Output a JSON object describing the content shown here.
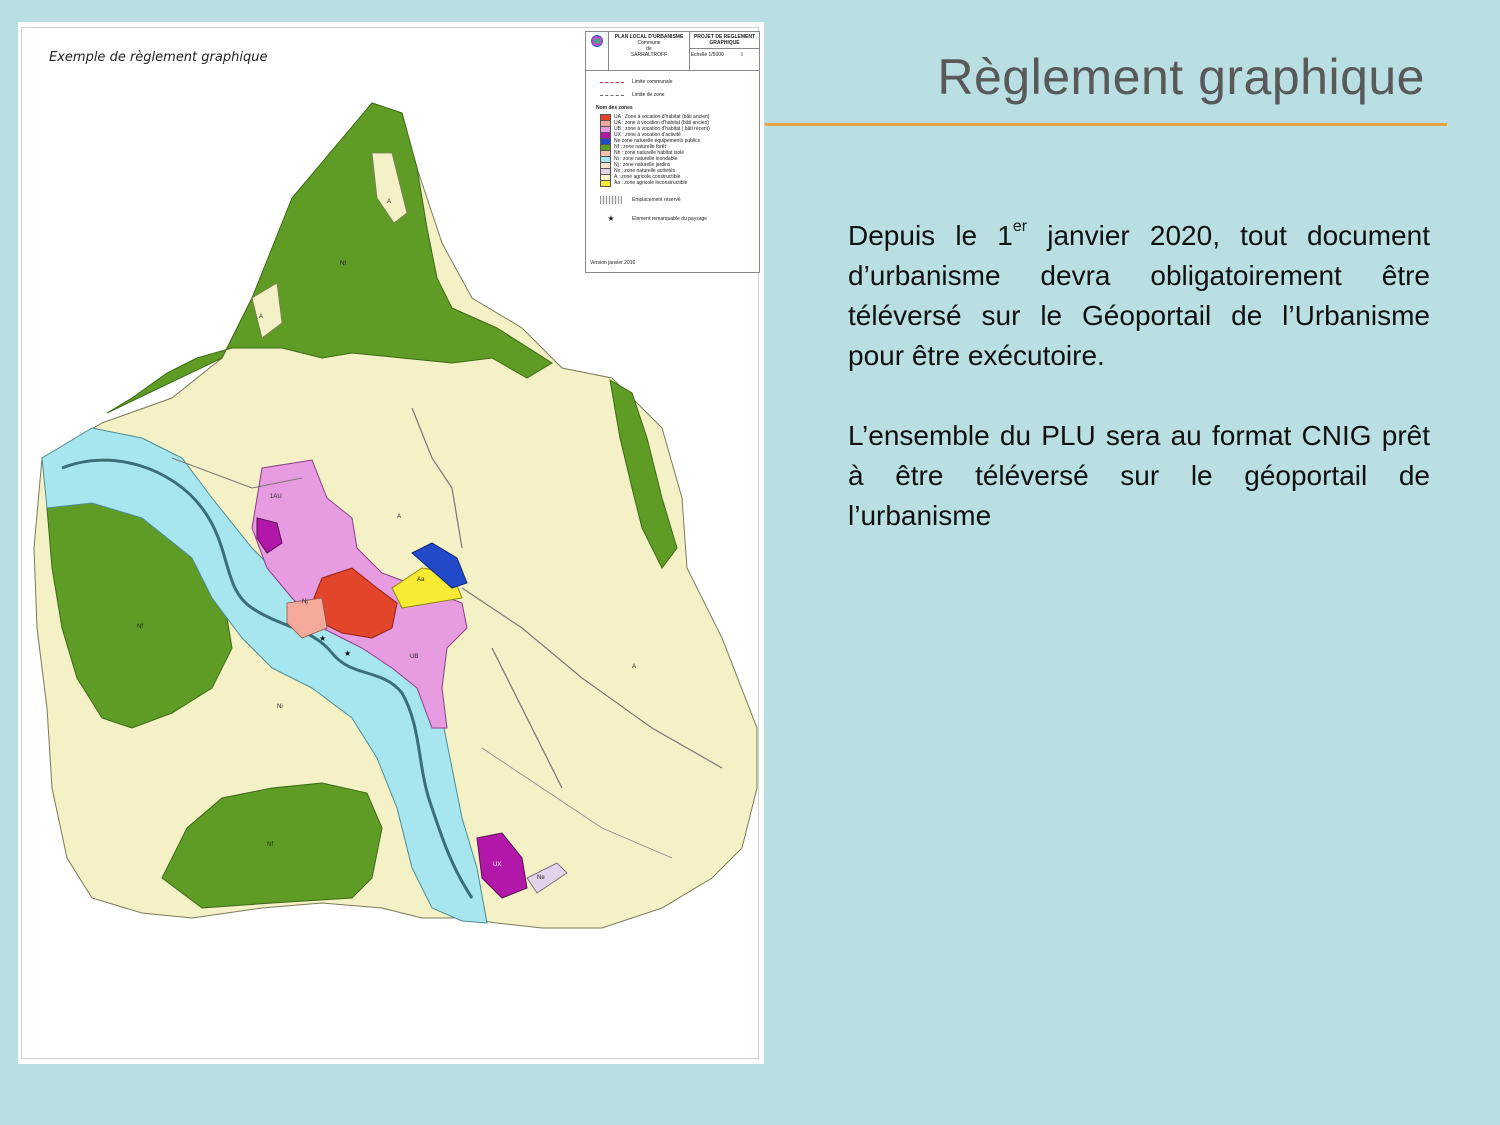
{
  "slide": {
    "title": "Règlement graphique",
    "paragraph1": {
      "part1": "Depuis le 1",
      "superscript": "er",
      "part2": " janvier 2020, tout document d’urbanisme devra obligatoirement être téléversé sur le Géoportail de l’Urbanisme pour être exécutoire."
    },
    "paragraph2": "L’ensemble du PLU sera au format CNIG prêt à être téléversé sur le géoportail de l’urbanisme",
    "colors": {
      "background": "#b9dfe2",
      "accent_rule": "#e6a23c",
      "title": "#595959"
    }
  },
  "map": {
    "caption": "Exemple de règlement graphique",
    "cartouche": {
      "plan_title": "PLAN LOCAL D'URBANISME",
      "commune_label": "Commune",
      "commune_de": "de",
      "commune_name": "SARRALTROFF",
      "project": "PROJET DE REGLEMENT GRAPHIQUE",
      "scale": "Echelle 1/5000"
    },
    "legend": {
      "limite_communale": "Limite communale",
      "limite_zone": "Limite de zone",
      "zones_heading": "Nom des zones",
      "zones": [
        {
          "label": "UA : Zone à vocation d'habitat (bâti ancien)",
          "color": "#e2452a"
        },
        {
          "label": "UA : zone à vocation d'habitat (bâti ancien)",
          "color": "#f4a99b"
        },
        {
          "label": "UB : zone à vocation d'habitat ( bâti récent)",
          "color": "#e79be0"
        },
        {
          "label": "UX : zone à vocation d'activité",
          "color": "#b317a9"
        },
        {
          "label": "Ne zone naturelle équipements publics",
          "color": "#2249c8"
        },
        {
          "label": "Nf : zone naturelle forêt",
          "color": "#5e9c25"
        },
        {
          "label": "Nh : zone naturelle habitat isolé",
          "color": "#f1c2b0"
        },
        {
          "label": "Ni : zone naturelle inondable",
          "color": "#a7e6ef"
        },
        {
          "label": "Nj : zone naturelle jardins",
          "color": "#f7e3c9"
        },
        {
          "label": "Nx : zone naturelle activités",
          "color": "#e2d3ea"
        },
        {
          "label": "A : zone agricole constructible",
          "color": "#f7f3c8"
        },
        {
          "label": "Aa : zone agricole inconstructible",
          "color": "#f6ea33"
        }
      ],
      "emplacement": "Emplacement réservé",
      "element": "Element remarquable du paysage",
      "version": "Version janvier 2016"
    },
    "labels": {
      "nf_top": "Nf",
      "nf_left": "Nf",
      "nf_bottom": "Nf",
      "a1": "A",
      "a2": "A",
      "a3": "A",
      "a4": "A",
      "aa": "Aa",
      "ub": "UB",
      "ux": "UX",
      "ne": "Ne",
      "ni": "Ni",
      "nj": "Nj",
      "uaq": "1AU"
    }
  }
}
